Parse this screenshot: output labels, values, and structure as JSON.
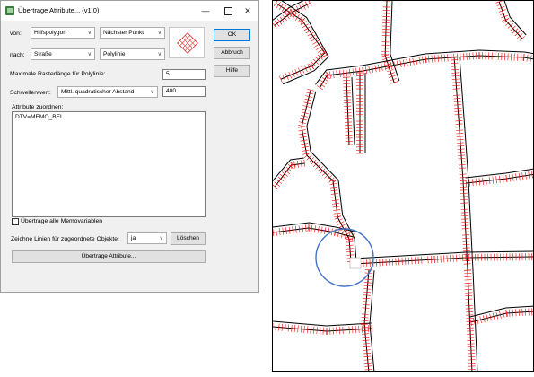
{
  "window": {
    "title": "Übertrage Attribute... (v1.0)",
    "minimize_glyph": "—",
    "maximize_glyph": "☐",
    "close_glyph": "✕"
  },
  "form": {
    "von_label": "von:",
    "von_value": "Hilfspolygon",
    "von_mode_value": "Nächster Punkt",
    "nach_label": "nach:",
    "nach_value": "Straße",
    "nach_mode_value": "Polylinie",
    "raster_label": "Maximale Rasterlänge für Polylinie:",
    "raster_value": "5",
    "schwellen_label": "Schwellenwert:",
    "schwellen_method": "Mittl. quadratischer Abstand",
    "schwellen_value": "400",
    "zuordnen_label": "Attribute zuordnen:",
    "zuordnen_text": "DTV=MEMO_BEL",
    "memovariablen_label": "Übertrage alle Memovariablen",
    "memovariablen_checked": false,
    "linien_label": "Zeichne Linien für zugeordnete Objekte:",
    "linien_value": "ja",
    "loeschen_label": "Löschen",
    "submit_label": "Übertrage Attribute..."
  },
  "buttons": {
    "ok": "OK",
    "abbruch": "Abbruch",
    "hilfe": "Hilfe"
  },
  "icons": {
    "app": "app-icon",
    "preview": "hatched-square-icon",
    "chevron": "chevron-down-icon"
  },
  "colors": {
    "road_outline": "#000000",
    "connector": "#ff0000",
    "circle": "#4472c4",
    "accent": "#0078d7"
  }
}
